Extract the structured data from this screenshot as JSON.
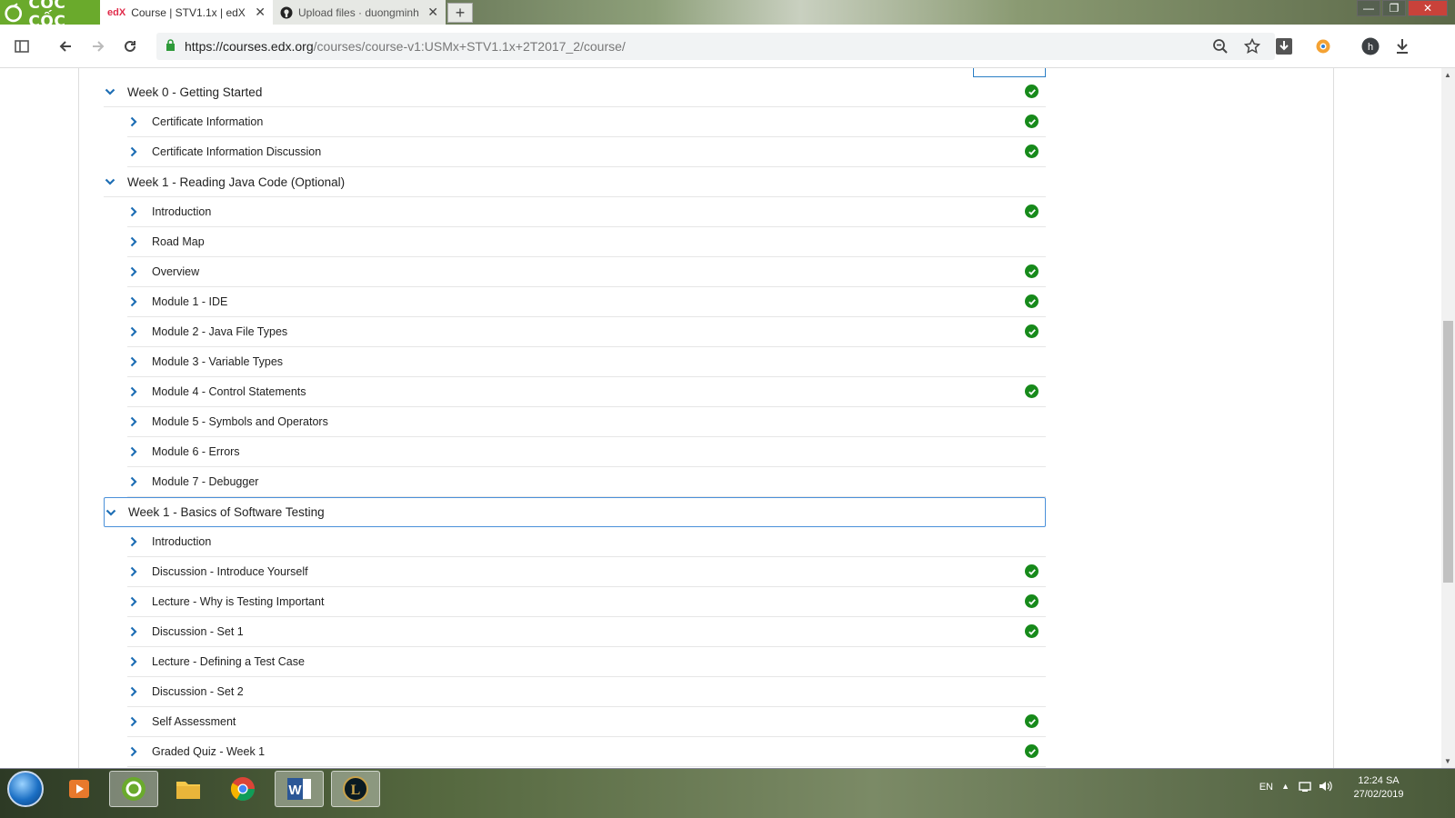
{
  "browser": {
    "brand": "CỐC CỐC",
    "tabs": [
      {
        "favicon": "edX",
        "title": "Course | STV1.1x | edX",
        "close": "✕"
      },
      {
        "favicon": "github-icon",
        "title": "Upload files · duongminh",
        "close": "✕"
      }
    ],
    "new_tab": "+",
    "url_host": "https://courses.edx.org",
    "url_path": "/courses/course-v1:USMx+STV1.1x+2T2017_2/course/",
    "window_controls": [
      "—",
      "❐",
      "✕"
    ]
  },
  "course_outline": {
    "sections": [
      {
        "title": "Week 0 - Getting Started",
        "completed": true,
        "subsections": [
          {
            "title": "Certificate Information",
            "completed": true
          },
          {
            "title": "Certificate Information Discussion",
            "completed": true
          }
        ]
      },
      {
        "title": "Week 1 - Reading Java Code (Optional)",
        "completed": false,
        "subsections": [
          {
            "title": "Introduction",
            "completed": true
          },
          {
            "title": "Road Map",
            "completed": false
          },
          {
            "title": "Overview",
            "completed": true
          },
          {
            "title": "Module 1 - IDE",
            "completed": true
          },
          {
            "title": "Module 2 - Java File Types",
            "completed": true
          },
          {
            "title": "Module 3 - Variable Types",
            "completed": false
          },
          {
            "title": "Module 4 - Control Statements",
            "completed": true
          },
          {
            "title": "Module 5 - Symbols and Operators",
            "completed": false
          },
          {
            "title": "Module 6 - Errors",
            "completed": false
          },
          {
            "title": "Module 7 - Debugger",
            "completed": false
          }
        ]
      },
      {
        "title": "Week 1 - Basics of Software Testing",
        "completed": false,
        "focused": true,
        "subsections": [
          {
            "title": "Introduction",
            "completed": false
          },
          {
            "title": "Discussion - Introduce Yourself",
            "completed": true
          },
          {
            "title": "Lecture - Why is Testing Important",
            "completed": true
          },
          {
            "title": "Discussion - Set 1",
            "completed": true
          },
          {
            "title": "Lecture - Defining a Test Case",
            "completed": false
          },
          {
            "title": "Discussion - Set 2",
            "completed": false
          },
          {
            "title": "Self Assessment",
            "completed": true
          },
          {
            "title": "Graded Quiz - Week 1",
            "completed": true
          }
        ]
      }
    ]
  },
  "taskbar": {
    "apps": [
      "media-player-icon",
      "coccoc-icon",
      "file-explorer-icon",
      "chrome-icon",
      "word-icon",
      "league-icon"
    ],
    "word_label": "W",
    "league_label": "L",
    "language": "EN",
    "time": "12:24 SA",
    "date": "27/02/2019"
  },
  "colors": {
    "brand_green": "#6aaa2c",
    "check_green": "#178a1b",
    "chevron_blue": "#1f6fb5",
    "focus_blue": "#4a90d9"
  }
}
